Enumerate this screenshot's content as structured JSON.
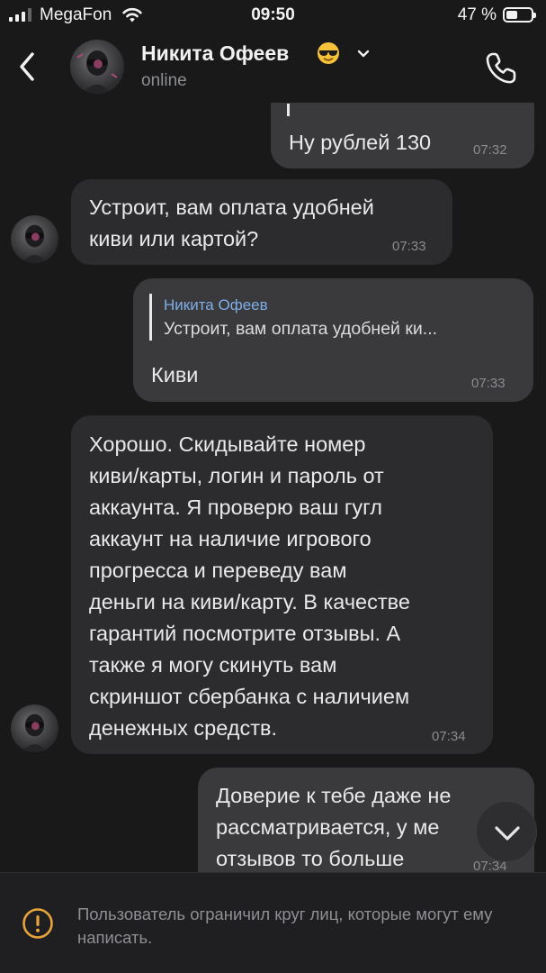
{
  "status_bar": {
    "carrier": "MegaFon",
    "time": "09:50",
    "battery": "47 %",
    "battery_level": 0.47
  },
  "header": {
    "contact_name": "Никита Офеев",
    "contact_emoji_icon": "sunglasses-emoji-icon",
    "contact_status": "online"
  },
  "messages": [
    {
      "side": "out",
      "text": "Ну рублей 130",
      "time": "07:32"
    },
    {
      "side": "in",
      "text": "Устроит, вам оплата удобней\nкиви или картой?",
      "time": "07:33"
    },
    {
      "side": "out",
      "reply": {
        "author": "Никита Офеев",
        "snippet": "Устроит, вам оплата удобней ки..."
      },
      "text": "Киви",
      "time": "07:33"
    },
    {
      "side": "in",
      "text": "Хорошо. Скидывайте номер\nкиви/карты, логин и пароль от\nаккаунта. Я проверю ваш гугл\nаккаунт на наличие игрового\nпрогресса и переведу вам\nденьги на киви/карту. В качестве\nгарантий посмотрите отзывы. А\nтакже я могу скинуть вам\nскриншот сбербанка с наличием\nденежных средств.",
      "time": "07:34"
    },
    {
      "side": "out",
      "text": "Доверие к тебе даже не\nрассматривается, у ме\nотзывов то больше",
      "time": "07:34"
    }
  ],
  "restriction": {
    "text": "Пользователь ограничил круг лиц, которые могут ему написать."
  }
}
